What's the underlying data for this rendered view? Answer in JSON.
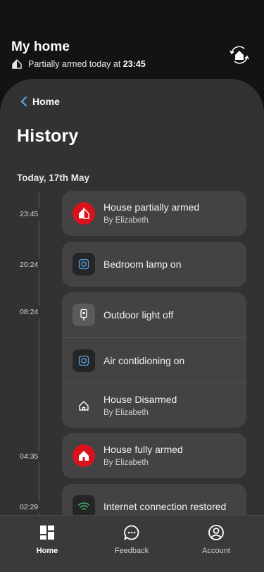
{
  "header": {
    "title": "My home",
    "status_prefix": "Partially armed today at",
    "status_time": "23:45"
  },
  "nav_back": {
    "label": "Home"
  },
  "page": {
    "title": "History",
    "date_heading": "Today, 17th May"
  },
  "timeline": [
    {
      "time": "23:45"
    },
    {
      "time": "20:24"
    },
    {
      "time": "08:24"
    },
    {
      "time": "04:35"
    },
    {
      "time": "02:29"
    }
  ],
  "events": {
    "house_partially_armed": {
      "title": "House partially armed",
      "sub": "By Elizabeth",
      "icon": "house-armed-partial-icon"
    },
    "bedroom_lamp_on": {
      "title": "Bedroom lamp on",
      "icon": "smart-plug-icon"
    },
    "outdoor_light_off": {
      "title": "Outdoor light off",
      "icon": "outdoor-light-icon"
    },
    "air_conditioning_on": {
      "title": "Air contidioning on",
      "icon": "smart-plug-icon"
    },
    "house_disarmed": {
      "title": "House Disarmed",
      "sub": "By Elizabeth",
      "icon": "house-outline-icon"
    },
    "house_fully_armed": {
      "title": "House fully armed",
      "sub": "By Elizabeth",
      "icon": "house-armed-full-icon"
    },
    "internet_restored": {
      "title": "Internet connection restored",
      "icon": "wifi-icon"
    }
  },
  "bottom_nav": {
    "home": "Home",
    "feedback": "Feedback",
    "account": "Account",
    "active": "home"
  },
  "colors": {
    "alarm_red": "#d9121e",
    "card_bg": "#434343",
    "sheet_bg": "#323232",
    "accent_blue": "#5aa6e8",
    "wifi_green": "#3fbf6f"
  }
}
